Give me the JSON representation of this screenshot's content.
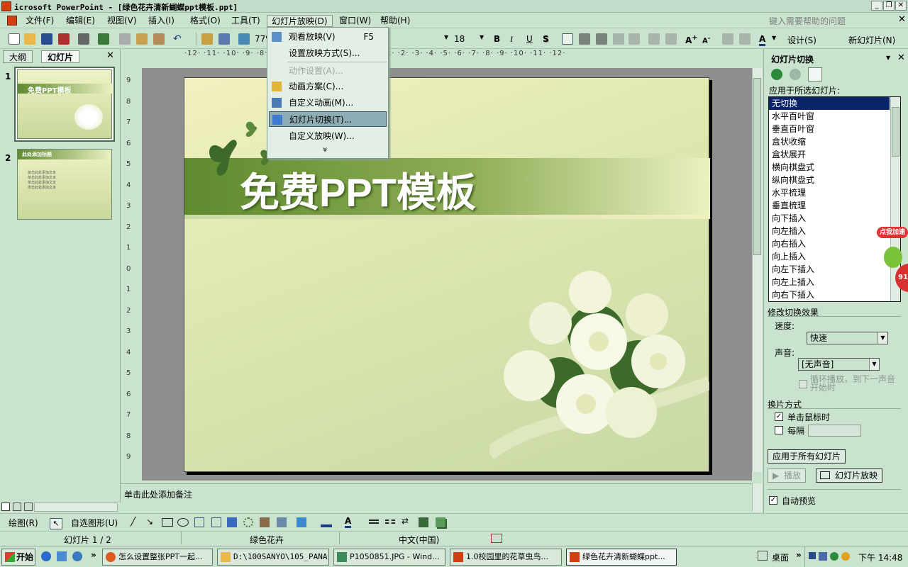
{
  "window": {
    "title": "icrosoft PowerPoint - [绿色花卉清新蝴蝶ppt模板.ppt]",
    "app_icon": "powerpoint-icon"
  },
  "menu": [
    "文件(F)",
    "编辑(E)",
    "视图(V)",
    "插入(I)",
    "格式(O)",
    "工具(T)",
    "幻灯片放映(D)",
    "窗口(W)",
    "帮助(H)"
  ],
  "help_placeholder": "键入需要帮助的问题",
  "toolbar": {
    "zoom": "77%",
    "font_size": "18",
    "bold": "B",
    "italic": "I",
    "underline": "U",
    "shadow": "S",
    "design": "设计(S)",
    "new_slide": "新幻灯片(N)",
    "font_color": "A"
  },
  "dropdown": {
    "items": [
      {
        "label": "观看放映(V)",
        "shortcut": "F5",
        "icon": "slideshow-icon"
      },
      {
        "label": "设置放映方式(S)...",
        "icon": ""
      },
      {
        "label": "动作设置(A)...",
        "icon": "",
        "disabled": true
      },
      {
        "label": "动画方案(C)...",
        "icon": "animation-scheme-icon"
      },
      {
        "label": "自定义动画(M)...",
        "icon": "custom-animation-icon"
      },
      {
        "label": "幻灯片切换(T)...",
        "icon": "slide-transition-icon",
        "highlighted": true
      },
      {
        "label": "自定义放映(W)...",
        "icon": ""
      }
    ],
    "expand": "»"
  },
  "left_tabs": {
    "outline": "大纲",
    "slides": "幻灯片"
  },
  "thumbs": [
    {
      "number": "1",
      "title": "免费PPT模板"
    },
    {
      "number": "2",
      "title": "此处添加标题",
      "lines": [
        "单击此处添加文本",
        "单击此处添加文本",
        "单击此处添加文本",
        "单击此处添加文本"
      ]
    }
  ],
  "slide": {
    "title": "免费PPT模板"
  },
  "ruler": {
    "h": "·12· ·11· ·10· ·9· ·8· ·7· ·6· ·5· ·4· ·3· ·2· ·1· ·0· ·1· ·2· ·3· ·4· ·5· ·6· ·7· ·8· ·9· ·10· ·11· ·12·",
    "v": [
      "9",
      "8",
      "7",
      "6",
      "5",
      "4",
      "3",
      "2",
      "1",
      "0",
      "1",
      "2",
      "3",
      "4",
      "5",
      "6",
      "7",
      "8",
      "9"
    ]
  },
  "notes": {
    "placeholder": "单击此处添加备注"
  },
  "taskpane": {
    "title": "幻灯片切换",
    "apply_label": "应用于所选幻灯片:",
    "transitions": [
      "无切换",
      "水平百叶窗",
      "垂直百叶窗",
      "盒状收缩",
      "盒状展开",
      "横向棋盘式",
      "纵向棋盘式",
      "水平梳理",
      "垂直梳理",
      "向下插入",
      "向左插入",
      "向右插入",
      "向上插入",
      "向左下插入",
      "向左上插入",
      "向右下插入"
    ],
    "modify_label": "修改切换效果",
    "speed_label": "速度:",
    "speed_value": "快速",
    "sound_label": "声音:",
    "sound_value": "[无声音]",
    "loop_label": "循环播放，到下一声音开始时",
    "advance_label": "换片方式",
    "on_click_label": "单击鼠标时",
    "every_label": "每隔",
    "apply_all": "应用于所有幻灯片",
    "play": "播放",
    "slideshow": "幻灯片放映",
    "auto_preview": "自动预览"
  },
  "overlay": {
    "badge": "点我加速",
    "number": "91"
  },
  "drawbar": {
    "draw": "绘图(R)",
    "autoshape": "自选图形(U)"
  },
  "status": {
    "slide": "幻灯片 1 / 2",
    "design": "绿色花卉",
    "language": "中文(中国)"
  },
  "taskbar": {
    "start": "开始",
    "buttons": [
      "怎么设置整张PPT一起...",
      "D:\\100SANYO\\105_PANA",
      "P1050851.JPG - Wind...",
      "1.0校园里的花草虫鸟...",
      "绿色花卉清新蝴蝶ppt..."
    ],
    "desktop": "桌面",
    "clock": "下午 14:48"
  },
  "colors": {
    "accent": "#0a246a",
    "theme": "#c9e3cf",
    "banner": "#5f8a2e"
  }
}
